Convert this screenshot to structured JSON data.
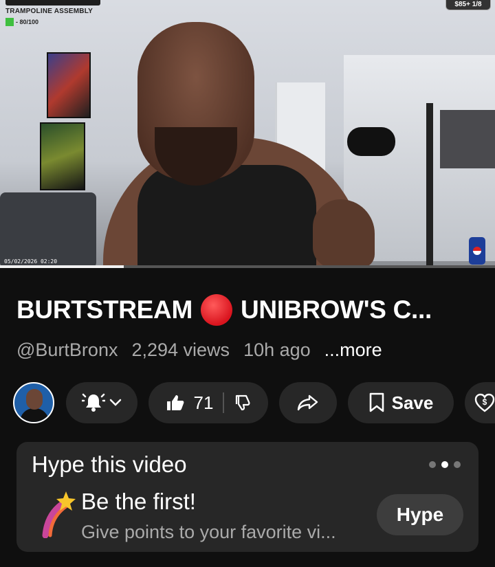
{
  "video": {
    "overlay_title": "TRAMPOLINE ASSEMBLY",
    "overlay_progress": "- 80/100",
    "top_right_badge": "$85+ 1/8",
    "timestamp": "05/02/2026 02:20",
    "playback_progress": 0.25
  },
  "title": {
    "part1": "BURTSTREAM",
    "part2": "UNIBROW'S C..."
  },
  "meta": {
    "channel": "@BurtBronx",
    "views": "2,294 views",
    "age": "10h ago",
    "more": "...more"
  },
  "actions": {
    "like_count": "71",
    "save_label": "Save"
  },
  "hype": {
    "heading": "Hype this video",
    "line1": "Be the first!",
    "line2": "Give points to your favorite vi...",
    "button": "Hype"
  },
  "colors": {
    "background": "#0f0f0f",
    "pill": "#272727",
    "muted_text": "#aaaaaa",
    "live_red": "#d9141e"
  }
}
